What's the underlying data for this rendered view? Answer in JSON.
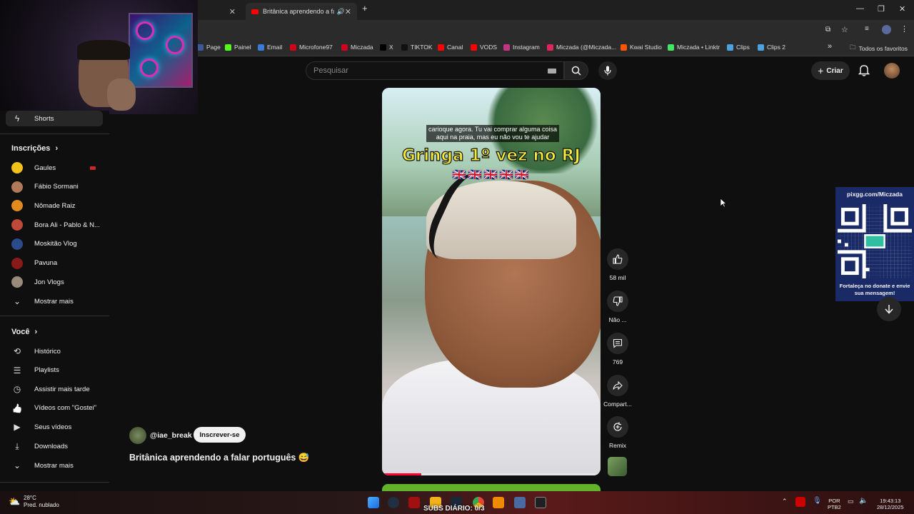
{
  "browser": {
    "tabs": [
      {
        "title": ""
      },
      {
        "title": "Britânica aprendendo a falar",
        "active": true
      }
    ],
    "new_tab": "+",
    "window_controls": [
      "—",
      "❐",
      "✕"
    ],
    "bookmarks": [
      {
        "label": "Page",
        "color": "#3b5998"
      },
      {
        "label": "Painel",
        "color": "#53fc18"
      },
      {
        "label": "Email",
        "color": "#3a7bd5"
      },
      {
        "label": "Microfone97",
        "color": "#d0021b"
      },
      {
        "label": "Miczada",
        "color": "#d0021b"
      },
      {
        "label": "X",
        "color": "#000000"
      },
      {
        "label": "TIKTOK",
        "color": "#111111"
      },
      {
        "label": "Canal",
        "color": "#ff0000"
      },
      {
        "label": "VODS",
        "color": "#ff0000"
      },
      {
        "label": "Instagram",
        "color": "#c13584"
      },
      {
        "label": "Miczada (@Miczada...",
        "color": "#e0245e"
      },
      {
        "label": "Kwai Studio",
        "color": "#ff5500"
      },
      {
        "label": "Miczada • Linktr",
        "color": "#43e660"
      },
      {
        "label": "Clips",
        "color": "#4aa3df"
      },
      {
        "label": "Clips 2",
        "color": "#4aa3df"
      }
    ],
    "more_bookmarks": "»",
    "all_favorites": "Todos os favoritos"
  },
  "header": {
    "search_placeholder": "Pesquisar",
    "create_label": "Criar"
  },
  "sidebar": {
    "shorts_label": "Shorts",
    "subscriptions_header": "Inscrições",
    "channels": [
      {
        "name": "Gaules",
        "color": "#f2c21a",
        "live": true
      },
      {
        "name": "Fábio Sormani",
        "color": "#b07a5a"
      },
      {
        "name": "Nômade Raiz",
        "color": "#e08a20"
      },
      {
        "name": "Bora Ali - Pablo & N...",
        "color": "#c04a3a"
      },
      {
        "name": "Moskitão Vlog",
        "color": "#2a4a8a"
      },
      {
        "name": "Pavuna",
        "color": "#8a1a1a"
      },
      {
        "name": "Jon Vlogs",
        "color": "#9a8a7a"
      }
    ],
    "show_more": "Mostrar mais",
    "you_header": "Você",
    "you_items": [
      {
        "label": "Histórico",
        "icon": "history-icon"
      },
      {
        "label": "Playlists",
        "icon": "playlist-icon"
      },
      {
        "label": "Assistir mais tarde",
        "icon": "clock-icon"
      },
      {
        "label": "Vídeos com \"Gostei\"",
        "icon": "thumbs-up-icon"
      },
      {
        "label": "Seus vídeos",
        "icon": "video-icon"
      },
      {
        "label": "Downloads",
        "icon": "download-icon"
      }
    ],
    "show_more_2": "Mostrar mais"
  },
  "short": {
    "caption": "carioque agora. Tu vai comprar alguma coisa aqui na praia, mas eu não vou te ajudar",
    "title_overlay": "Gringa 1º vez no RJ",
    "flags": "🇬🇧🇬🇧🇬🇧🇬🇧🇬🇧",
    "progress": 0.18,
    "creator": "@iae_break",
    "subscribe_label": "Inscrever-se",
    "title": "Britânica aprendendo a falar português 😅"
  },
  "actions": {
    "likes": "58 mil",
    "dislike": "Não ...",
    "comments": "769",
    "share": "Compart...",
    "remix": "Remix"
  },
  "pix": {
    "url": "pixgg.com/Miczada",
    "message": "Fortaleça no donate e envie sua mensagem!"
  },
  "taskbar": {
    "temperature": "28°C",
    "weather": "Pred. nublado",
    "subs_text": "SUBS DIÁRIO: 0/3",
    "lang_top": "POR",
    "lang_bottom": "PTB2",
    "time": "19:43:13",
    "date": "28/12/2025"
  }
}
